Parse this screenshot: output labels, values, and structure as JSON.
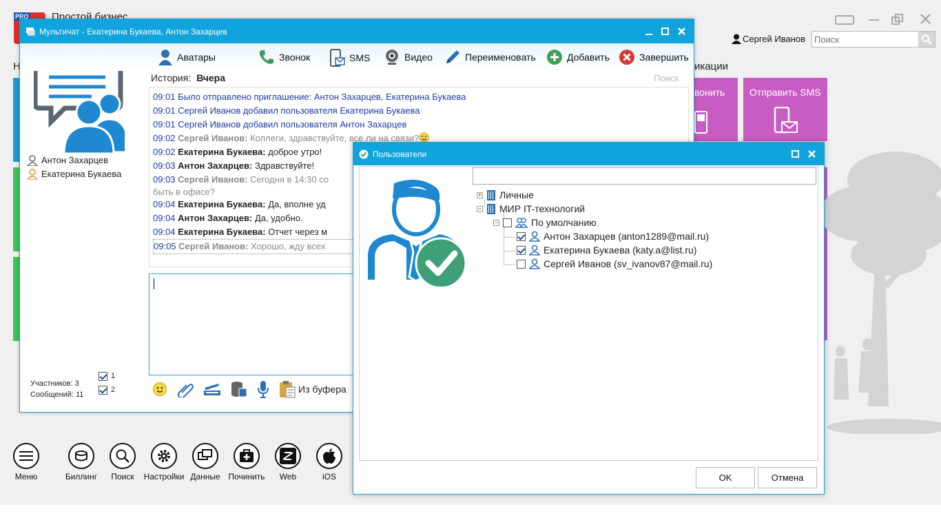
{
  "app": {
    "title": "Простой бизнес",
    "logo_badge": "PRO",
    "user": "Сергей Иванов",
    "search_placeholder": "Поиск",
    "menu_fragment_left": "Н",
    "menu_fragment_right": "икации",
    "tiles": {
      "call_label": "вонить",
      "sms_label": "Отправить SMS"
    },
    "bottom_buttons": [
      "Меню",
      "Биллинг",
      "Поиск",
      "Настройки",
      "Данные",
      "Починить",
      "Web",
      "iOS"
    ]
  },
  "chat": {
    "title": "Мультичат  - Екатерина Букаева, Антон Захарцев",
    "toolbar": {
      "avatars": "Аватары",
      "call": "Звонок",
      "sms": "SMS",
      "video": "Видео",
      "rename": "Переименовать",
      "add": "Добавить",
      "finish": "Завершить"
    },
    "history_label": "История:",
    "history_value": "Вчера",
    "history_search": "Поиск",
    "participants": [
      "Антон Захарцев",
      "Екатерина Букаева"
    ],
    "messages": [
      {
        "time": "09:01",
        "author": "",
        "text": "Было отправлено приглашение: Антон Захарцев, Екатерина Букаева"
      },
      {
        "time": "09:01",
        "author": "",
        "text": "Сергей Иванов добавил пользователя Екатерина Букаева"
      },
      {
        "time": "09:01",
        "author": "",
        "text": "Сергей Иванов добавил пользователя Антон Захарцев"
      },
      {
        "time": "09:02",
        "author": "Сергей Иванов:",
        "text": "Коллеги, здравствуйте, все ли на связи?"
      },
      {
        "time": "09:02",
        "author": "Екатерина Букаева:",
        "text": "доброе утро!"
      },
      {
        "time": "09:03",
        "author": "Антон Захарцев:",
        "text": "Здравствуйте!"
      },
      {
        "time": "09:03",
        "author": "Сергей Иванов:",
        "text": "Сегодня в 14:30 со"
      },
      {
        "time": "",
        "author": "",
        "text": "быть в офисе?"
      },
      {
        "time": "09:04",
        "author": "Екатерина Букаева:",
        "text": "Да, вполне уд"
      },
      {
        "time": "09:04",
        "author": "Антон Захарцев:",
        "text": "Да, удобно."
      },
      {
        "time": "09:04",
        "author": "Екатерина Букаева:",
        "text": "Отчет через м"
      },
      {
        "time": "09:05",
        "author": "Сергей Иванов:",
        "text": "Хорошо, жду всех"
      }
    ],
    "compose_bar": {
      "clipboard": "Из буфера"
    },
    "stats": {
      "participants": "Участников: 3",
      "messages": "Сообщений: 11"
    },
    "checks": [
      "1",
      "2"
    ]
  },
  "dialog": {
    "title": "Пользователи",
    "filter_value": "",
    "tree": {
      "personal": "Личные",
      "org": "МИР IT-технологий",
      "group": "По умолчанию",
      "users": [
        {
          "label": "Антон Захарцев (anton1289@mail.ru)",
          "checked": true
        },
        {
          "label": "Екатерина Букаева (katy.a@list.ru)",
          "checked": true
        },
        {
          "label": "Сергей Иванов (sv_ivanov87@mail.ru)",
          "checked": false
        }
      ]
    },
    "ok": "OK",
    "cancel": "Отмена"
  },
  "colors": {
    "titlebar": "#10a3dc",
    "tile_magenta": "#c95cc2",
    "tile_blue": "#1a9fd6",
    "tile_green": "#3cc45a",
    "system_message": "#1e3aa8",
    "avatar_blue": "#1e88d0",
    "check_green": "#3fa077"
  }
}
